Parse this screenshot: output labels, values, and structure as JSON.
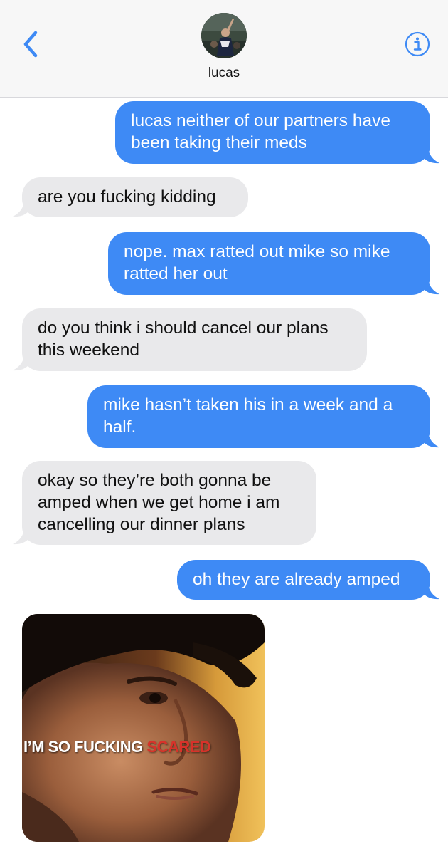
{
  "header": {
    "contact_name": "lucas",
    "back_icon": "chevron-left-icon",
    "info_icon": "info-icon",
    "accent_color": "#3e8af5"
  },
  "messages": [
    {
      "direction": "sent",
      "text_lines": [
        "lucas neither of our partners have",
        "been taking their meds"
      ]
    },
    {
      "direction": "received",
      "text_lines": [
        "are you fucking kidding"
      ]
    },
    {
      "direction": "sent",
      "text_lines": [
        "nope. max ratted out mike so mike",
        "ratted her out"
      ]
    },
    {
      "direction": "received",
      "text_lines": [
        "do you think i should cancel our plans",
        "this weekend"
      ]
    },
    {
      "direction": "sent",
      "text_lines": [
        "mike hasn’t taken his in a week and a",
        "half."
      ]
    },
    {
      "direction": "received",
      "text_lines": [
        "okay so they’re both gonna be",
        "amped when we get home i am",
        "cancelling our dinner plans"
      ]
    },
    {
      "direction": "sent",
      "text_lines": [
        "oh they are already amped"
      ]
    },
    {
      "direction": "received",
      "type": "image",
      "caption_white": "I’M SO FUCKING ",
      "caption_red": "SCARED"
    }
  ],
  "colors": {
    "sent_bubble": "#3e8af5",
    "received_bubble": "#e9e9eb"
  }
}
